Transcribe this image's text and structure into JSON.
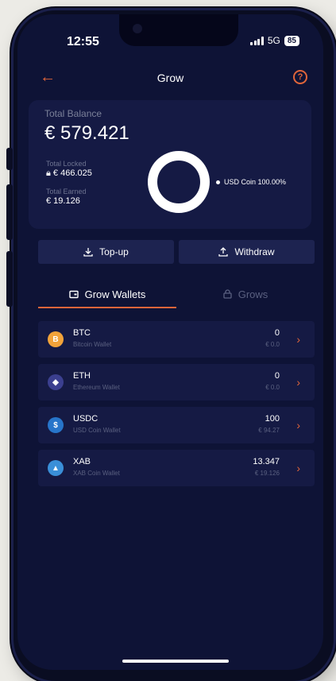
{
  "status": {
    "time": "12:55",
    "network": "5G",
    "battery": "85"
  },
  "header": {
    "title": "Grow"
  },
  "balance": {
    "total_label": "Total Balance",
    "total_value": "€ 579.421",
    "locked_label": "Total Locked",
    "locked_value": "€ 466.025",
    "earned_label": "Total Earned",
    "earned_value": "€ 19.126",
    "legend": "USD Coin 100.00%",
    "allocation": [
      {
        "name": "USD Coin",
        "percent": 100.0
      }
    ]
  },
  "actions": {
    "topup_label": "Top-up",
    "withdraw_label": "Withdraw"
  },
  "tabs": [
    {
      "label": "Grow Wallets",
      "active": true
    },
    {
      "label": "Grows",
      "active": false
    }
  ],
  "wallets": [
    {
      "symbol": "BTC",
      "name": "Bitcoin Wallet",
      "amount": "0",
      "eur": "€ 0.0",
      "color": "#f2a33a",
      "glyph": "B"
    },
    {
      "symbol": "ETH",
      "name": "Ethereum Wallet",
      "amount": "0",
      "eur": "€ 0.0",
      "color": "#3b3f8f",
      "glyph": "◆"
    },
    {
      "symbol": "USDC",
      "name": "USD Coin Wallet",
      "amount": "100",
      "eur": "€ 94.27",
      "color": "#2775ca",
      "glyph": "$"
    },
    {
      "symbol": "XAB",
      "name": "XAB Coin Wallet",
      "amount": "13.347",
      "eur": "€ 19.126",
      "color": "#3a8fd8",
      "glyph": "▲"
    }
  ],
  "colors": {
    "accent": "#e0653a",
    "background": "#0e1336",
    "card": "#151a44"
  }
}
